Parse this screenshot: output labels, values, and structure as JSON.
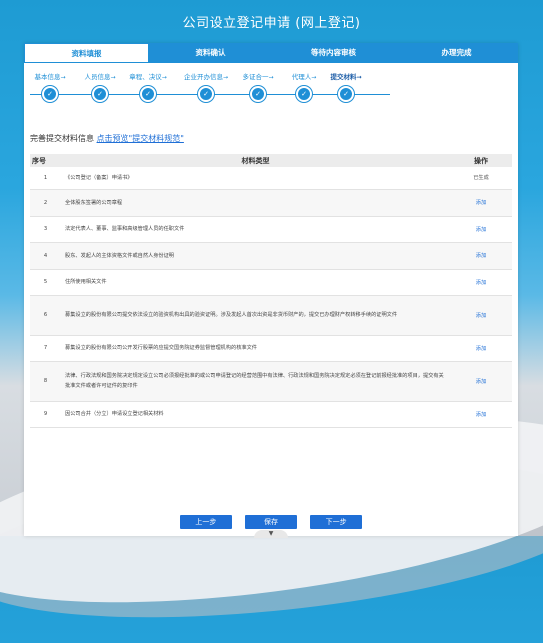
{
  "page": {
    "title": "公司设立登记申请 (网上登记)"
  },
  "tabs": [
    {
      "label": "资料填报",
      "active": true
    },
    {
      "label": "资料确认",
      "active": false
    },
    {
      "label": "等待内容审核",
      "active": false
    },
    {
      "label": "办理完成",
      "active": false
    }
  ],
  "steps": [
    {
      "label": "基本信息"
    },
    {
      "label": "人员信息"
    },
    {
      "label": "章程、决议"
    },
    {
      "label": "企业开办信息"
    },
    {
      "label": "多证合一"
    },
    {
      "label": "代理人"
    },
    {
      "label": "提交材料",
      "active": true
    }
  ],
  "step_arrow": "→",
  "step_check": "✓",
  "section": {
    "title": "完善提交材料信息",
    "link": "点击预览\"提交材料规范\""
  },
  "table": {
    "headers": {
      "no": "序号",
      "type": "材料类型",
      "op": "操作"
    },
    "rows": [
      {
        "no": "1",
        "type": "《公司登记（备案）申请书》",
        "op": "已生成",
        "done": true
      },
      {
        "no": "2",
        "type": "全体股东签署的公司章程",
        "op": "添加"
      },
      {
        "no": "3",
        "type": "法定代表人、董事、监事和高级管理人员的任职文件",
        "op": "添加"
      },
      {
        "no": "4",
        "type": "股东、发起人的主体资格文件或自然人身份证明",
        "op": "添加"
      },
      {
        "no": "5",
        "type": "住所使用相关文件",
        "op": "添加"
      },
      {
        "no": "6",
        "type": "募集设立的股份有限公司提交依法设立的验资机构出具的验资证明。涉及发起人首次出资是非货币财产的，提交已办理财产权转移手续的证明文件",
        "op": "添加"
      },
      {
        "no": "7",
        "type": "募集设立的股份有限公司公开发行股票的应提交国务院证券监督管理机构的核准文件",
        "op": "添加"
      },
      {
        "no": "8",
        "type": "法律、行政法规和国务院决定规定设立公司必须报经批准的或公司申请登记的经营范围中有法律、行政法规和国务院决定规定必须在登记前报经批准的项目，提交有关批准文件或者许可证件的复印件",
        "op": "添加"
      },
      {
        "no": "9",
        "type": "因公司合并（分立）申请设立登记相关材料",
        "op": "添加"
      }
    ]
  },
  "buttons": {
    "prev": "上一步",
    "save": "保存",
    "next": "下一步"
  },
  "collapse_icon": "▼"
}
